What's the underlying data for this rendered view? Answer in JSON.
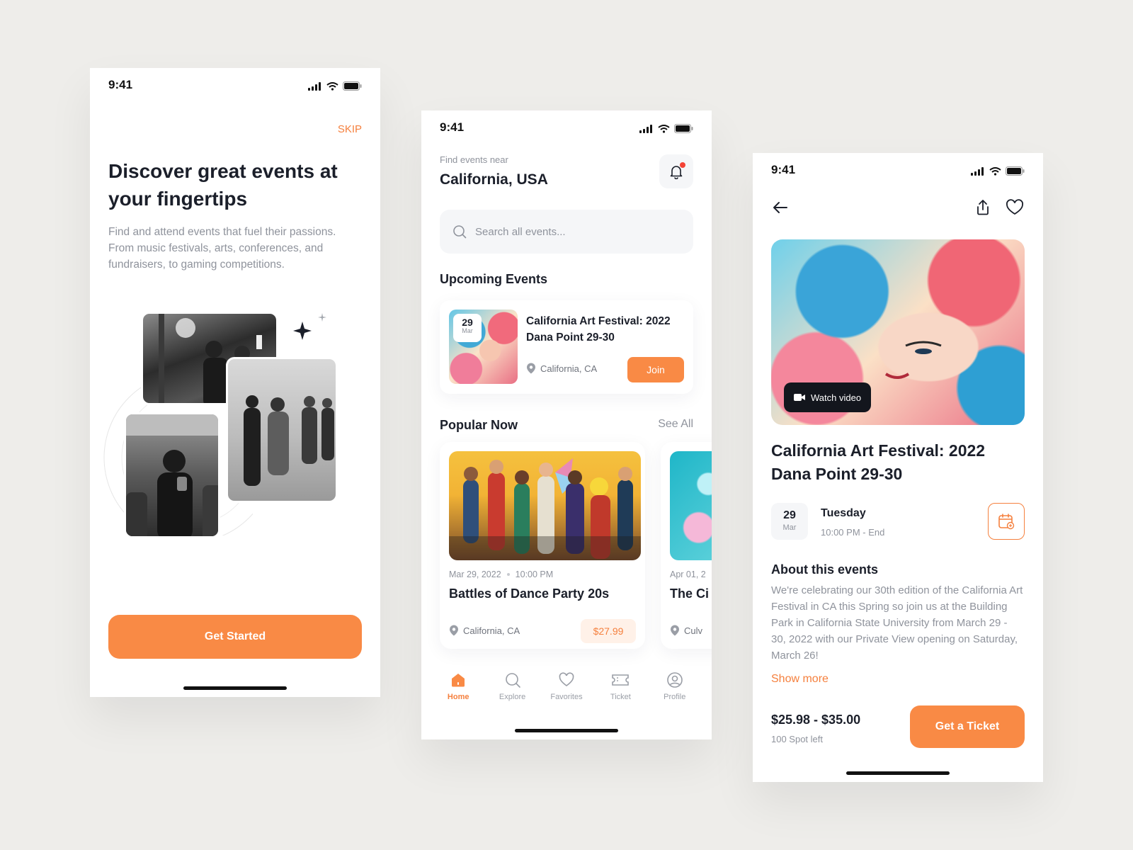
{
  "status": {
    "time": "9:41"
  },
  "onboarding": {
    "skip": "SKIP",
    "title": "Discover great events at your fingertips",
    "description": "Find and attend events that fuel their passions. From music festivals, arts, conferences, and fundraisers, to gaming competitions.",
    "cta": "Get Started"
  },
  "home": {
    "find_label": "Find events near",
    "location": "California, USA",
    "search_placeholder": "Search all events...",
    "upcoming_title": "Upcoming Events",
    "upcoming": {
      "day": "29",
      "month": "Mar",
      "title": "California Art Festival: 2022 Dana Point 29-30",
      "location": "California, CA",
      "join": "Join"
    },
    "popular_title": "Popular Now",
    "see_all": "See All",
    "popular": [
      {
        "date": "Mar 29, 2022",
        "time": "10:00 PM",
        "title": "Battles of Dance Party 20s",
        "location": "California, CA",
        "price": "$27.99"
      },
      {
        "date": "Apr 01, 2",
        "title": "The Ci",
        "location": "Culv"
      }
    ],
    "tabs": [
      {
        "label": "Home",
        "icon": "home-icon"
      },
      {
        "label": "Explore",
        "icon": "search-icon"
      },
      {
        "label": "Favorites",
        "icon": "heart-icon"
      },
      {
        "label": "Ticket",
        "icon": "ticket-icon"
      },
      {
        "label": "Profile",
        "icon": "profile-icon"
      }
    ]
  },
  "detail": {
    "watch_video": "Watch video",
    "title": "California Art Festival: 2022 Dana Point 29-30",
    "day": "29",
    "month": "Mar",
    "weekday": "Tuesday",
    "time": "10:00 PM - End",
    "about_title": "About this events",
    "about_body": "We're celebrating our 30th edition of the California Art Festival in CA this Spring so join us at the Building Park in California State University from March 29 - 30, 2022 with our Private View opening on Saturday, March 26!",
    "show_more": "Show more",
    "price_range": "$25.98 - $35.00",
    "spots": "100 Spot left",
    "cta": "Get a Ticket"
  },
  "colors": {
    "accent": "#f98a45",
    "accent_text": "#f5803e",
    "background": "#eeedea"
  }
}
